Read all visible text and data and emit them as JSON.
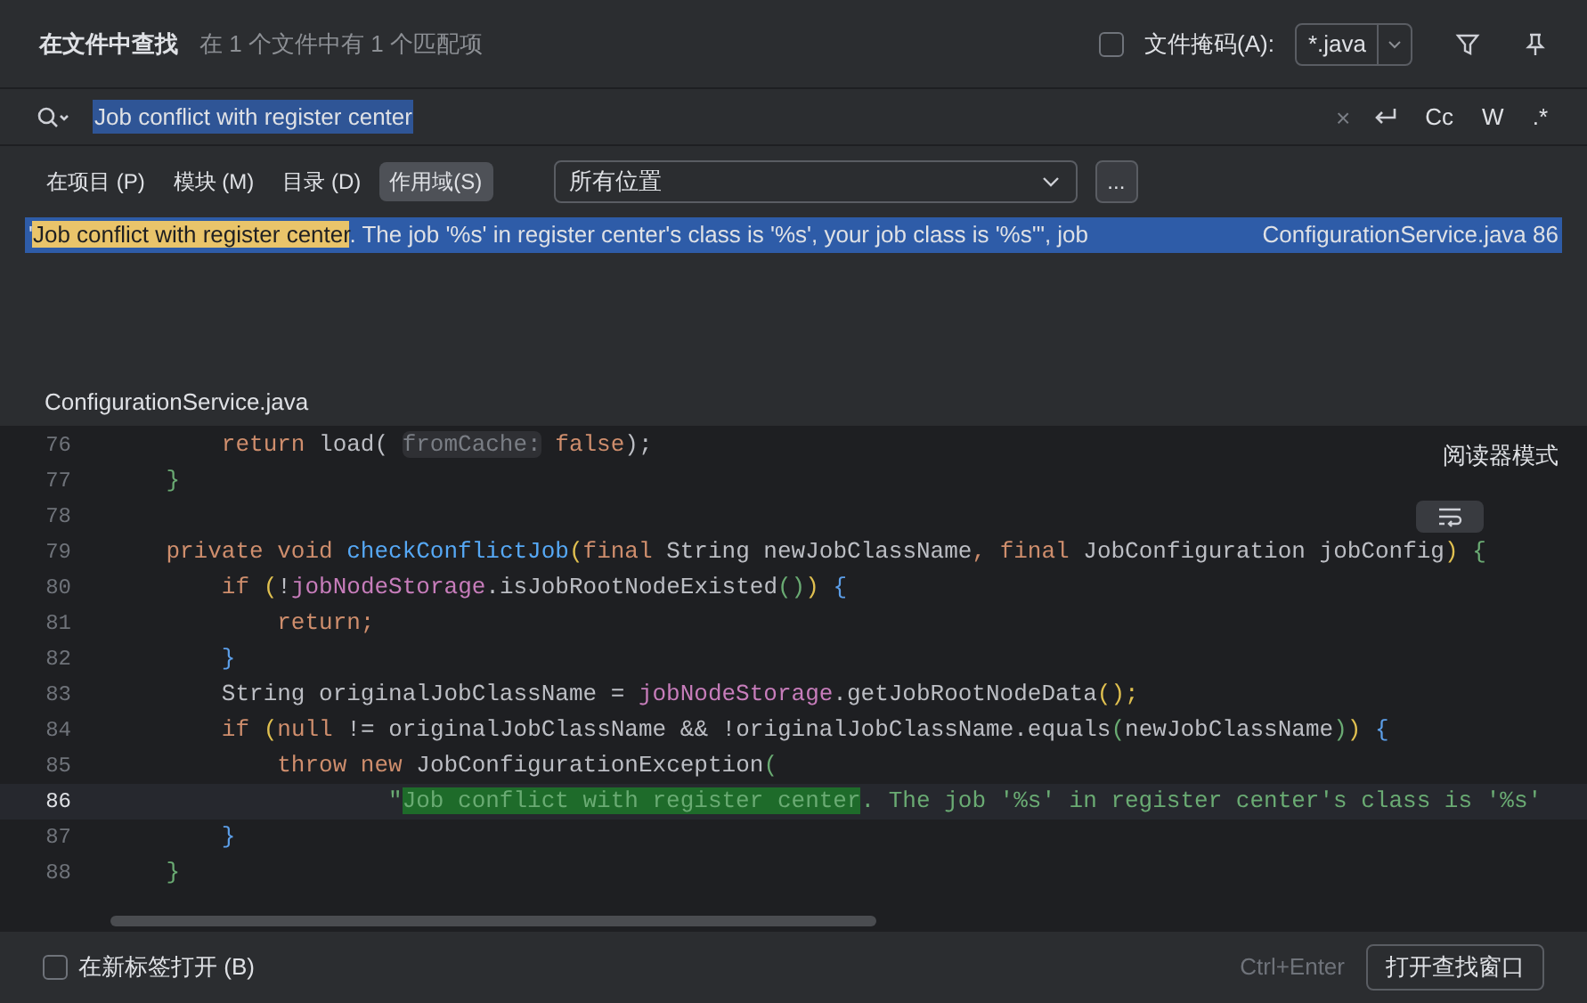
{
  "header": {
    "title": "在文件中查找",
    "summary": "在 1 个文件中有 1 个匹配项",
    "file_mask": {
      "label": "文件掩码(A):",
      "checked": false,
      "value": "*.java"
    }
  },
  "search": {
    "query": "Job conflict with register center",
    "clear": "×",
    "options": [
      "Cc",
      "W",
      ".*"
    ]
  },
  "scopes": [
    {
      "label": "在项目 (P)",
      "selected": false
    },
    {
      "label": "模块 (M)",
      "selected": false
    },
    {
      "label": "目录 (D)",
      "selected": false
    },
    {
      "label": "作用域(S)",
      "selected": true
    }
  ],
  "scope_dropdown": {
    "value": "所有位置",
    "more": "..."
  },
  "results": [
    {
      "prefix": "'",
      "match": "Job conflict with register center",
      "rest": ". The job '%s' in register center's class is '%s', your job class is '%s'\", job",
      "location": "ConfigurationService.java 86",
      "selected": true
    }
  ],
  "preview": {
    "file": "ConfigurationService.java",
    "reader_mode": "阅读器模式",
    "lines": [
      {
        "number": "76",
        "current": false,
        "tokens": [
          {
            "kind": "keyword",
            "text": "        return"
          },
          {
            "kind": "plain",
            "text": " load( "
          },
          {
            "kind": "hint",
            "text": "fromCache:"
          },
          {
            "kind": "keyword",
            "text": " false"
          },
          {
            "kind": "plain",
            "text": ");"
          }
        ]
      },
      {
        "number": "77",
        "current": false,
        "tokens": [
          {
            "kind": "brace-green",
            "text": "    }"
          }
        ]
      },
      {
        "number": "78",
        "current": false
      },
      {
        "number": "79",
        "current": false,
        "tokens": [
          {
            "kind": "keyword",
            "text": "    private void "
          },
          {
            "kind": "declaration",
            "text": "checkConflictJob"
          },
          {
            "kind": "brace-gold",
            "text": "("
          },
          {
            "kind": "keyword",
            "text": "final "
          },
          {
            "kind": "plain",
            "text": "String newJobClassName"
          },
          {
            "kind": "keyword",
            "text": ", final "
          },
          {
            "kind": "plain",
            "text": "JobConfiguration jobConfig"
          },
          {
            "kind": "brace-gold",
            "text": ")"
          },
          {
            "kind": "brace-green",
            "text": " {"
          }
        ]
      },
      {
        "number": "80",
        "current": false,
        "tokens": [
          {
            "kind": "keyword",
            "text": "        if "
          },
          {
            "kind": "brace-gold",
            "text": "("
          },
          {
            "kind": "plain",
            "text": "!"
          },
          {
            "kind": "field",
            "text": "jobNodeStorage"
          },
          {
            "kind": "plain",
            "text": ".isJobRootNodeExisted"
          },
          {
            "kind": "brace-green",
            "text": "()"
          },
          {
            "kind": "brace-gold",
            "text": ")"
          },
          {
            "kind": "brace-blue",
            "text": " {"
          }
        ]
      },
      {
        "number": "81",
        "current": false,
        "tokens": [
          {
            "kind": "keyword",
            "text": "            return;"
          }
        ]
      },
      {
        "number": "82",
        "current": false,
        "tokens": [
          {
            "kind": "brace-blue",
            "text": "        }"
          }
        ]
      },
      {
        "number": "83",
        "current": false,
        "tokens": [
          {
            "kind": "plain",
            "text": "        String originalJobClassName = "
          },
          {
            "kind": "field",
            "text": "jobNodeStorage"
          },
          {
            "kind": "plain",
            "text": ".getJobRootNodeData"
          },
          {
            "kind": "brace-gold",
            "text": "();"
          }
        ]
      },
      {
        "number": "84",
        "current": false,
        "tokens": [
          {
            "kind": "keyword",
            "text": "        if "
          },
          {
            "kind": "brace-gold",
            "text": "("
          },
          {
            "kind": "keyword",
            "text": "null"
          },
          {
            "kind": "plain",
            "text": " != originalJobClassName && !originalJobClassName.equals"
          },
          {
            "kind": "brace-green",
            "text": "("
          },
          {
            "kind": "plain",
            "text": "newJobClassName"
          },
          {
            "kind": "brace-green",
            "text": ")"
          },
          {
            "kind": "brace-gold",
            "text": ")"
          },
          {
            "kind": "brace-blue",
            "text": " {"
          }
        ]
      },
      {
        "number": "85",
        "current": false,
        "tokens": [
          {
            "kind": "keyword",
            "text": "            throw new "
          },
          {
            "kind": "plain",
            "text": "JobConfigurationException"
          },
          {
            "kind": "brace-green",
            "text": "("
          }
        ]
      },
      {
        "number": "86",
        "current": true,
        "tokens": [
          {
            "kind": "string",
            "text": "                    \""
          },
          {
            "kind": "match",
            "text": "Job conflict with register center"
          },
          {
            "kind": "string",
            "text": ". The job '%s' in register center's class is '%s'"
          }
        ]
      },
      {
        "number": "87",
        "current": false,
        "tokens": [
          {
            "kind": "brace-blue",
            "text": "        }"
          }
        ]
      },
      {
        "number": "88",
        "current": false,
        "tokens": [
          {
            "kind": "brace-green",
            "text": "    }"
          }
        ]
      }
    ]
  },
  "footer": {
    "new_tab": {
      "label": "在新标签打开 (B)",
      "checked": false
    },
    "shortcut": "Ctrl+Enter",
    "open_button": "打开查找窗口"
  }
}
